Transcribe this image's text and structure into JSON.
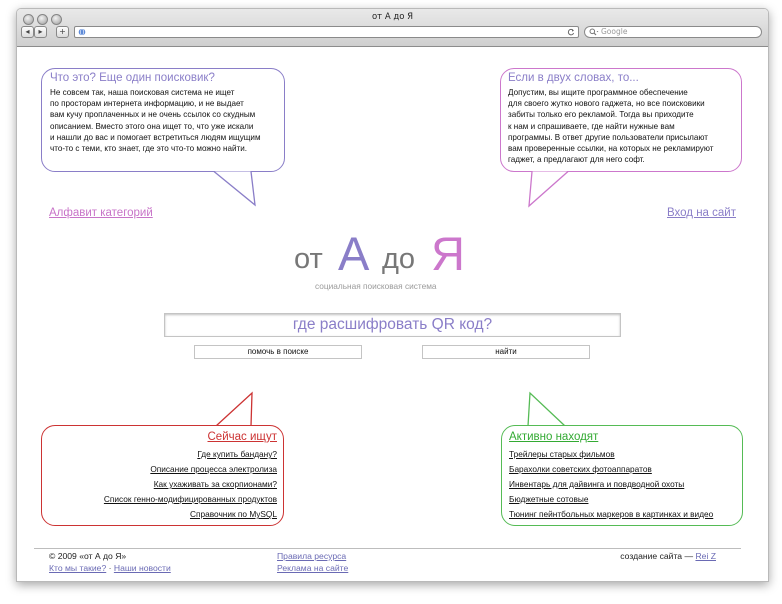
{
  "browser": {
    "title": "от А до Я",
    "search_placeholder": "Google"
  },
  "bubbles": {
    "what": {
      "title": "Что это? Еще один поисковик?",
      "lines": [
        "Не совсем так, наша поисковая система не ищет",
        "по просторам интернета информацию, и не выдает",
        "вам кучу проплаченных и не очень ссылок со скудным",
        "описанием. Вместо этого она ищет то, что уже искали",
        "и нашли до вас и помогает встретиться людям ищущим",
        "что-то с теми, кто знает, где это что-то можно найти."
      ]
    },
    "brief": {
      "title": "Если в двух словах, то...",
      "lines": [
        "Допустим, вы ищите программное обеспечение",
        "для своего жутко нового гаджета, но все поисковики",
        "забиты только его рекламой. Тогда вы приходите",
        "к нам и спрашиваете, где найти нужные вам",
        "программы. В ответ другие пользователи присылают",
        "вам проверенные ссылки, на которых не рекламируют",
        "гаджет, а предлагают для него софт."
      ]
    },
    "searching": {
      "title": "Сейчас ищут",
      "items": [
        "Где купить бандану?",
        "Описание процесса электролиза",
        "Как ухаживать за скорпионами?",
        "Список генно-модифицированных продуктов",
        "Справочник по MySQL"
      ]
    },
    "finding": {
      "title": "Активно находят",
      "items": [
        "Трейлеры старых фильмов",
        "Барахолки советских фотоаппаратов",
        "Инвентарь для дайвинга и повдводной охоты",
        "Бюджетные сотовые",
        "Тюнинг пейнтбольных маркеров в картинках и видео"
      ]
    }
  },
  "nav": {
    "categories": "Алфавит категорий",
    "login": "Вход на сайт"
  },
  "logo": {
    "from": "от",
    "a": "А",
    "to": "до",
    "ya": "Я",
    "tagline": "социальная поисковая система"
  },
  "search": {
    "value": "где расшифровать QR код?",
    "help_button": "помочь в поиске",
    "find_button": "найти"
  },
  "footer": {
    "copyright": "© 2009 «от А до Я»",
    "who": "Кто мы такие?",
    "separator": "·",
    "news": "Наши новости",
    "rules": "Правила ресурса",
    "ads": "Реклама на сайте",
    "made_by": "создание сайта —",
    "author": "Rei Z"
  },
  "colors": {
    "purple": "#8a7ec8",
    "pink": "#cc77cc",
    "red": "#cc3333",
    "green": "#55bb55",
    "logo_gray": "#777777",
    "link_blue": "#6a6ab4"
  }
}
